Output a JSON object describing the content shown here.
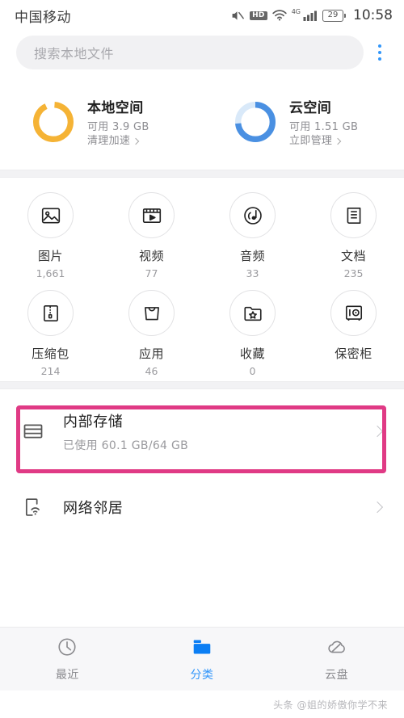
{
  "statusbar": {
    "carrier": "中国移动",
    "hd_label": "HD",
    "network_label": "4G",
    "battery_level": "29",
    "time": "10:58",
    "icons": [
      "mute-icon",
      "hd-icon",
      "wifi-icon",
      "signal-icon",
      "battery-icon"
    ]
  },
  "search": {
    "placeholder": "搜索本地文件",
    "menu_icon": "kebab-menu-icon"
  },
  "storage": {
    "local": {
      "title": "本地空间",
      "available": "可用 3.9 GB",
      "action": "清理加速",
      "ring_color": "#F5B335",
      "ring_track": "#ffffff",
      "ring_percent": 92
    },
    "cloud": {
      "title": "云空间",
      "available": "可用 1.51 GB",
      "action": "立即管理",
      "ring_color": "#4A90E2",
      "ring_track": "#D9E9F9",
      "ring_percent": 74
    }
  },
  "categories": [
    {
      "label": "图片",
      "count": "1,661",
      "icon": "image-icon"
    },
    {
      "label": "视频",
      "count": "77",
      "icon": "video-icon"
    },
    {
      "label": "音频",
      "count": "33",
      "icon": "audio-icon"
    },
    {
      "label": "文档",
      "count": "235",
      "icon": "document-icon"
    },
    {
      "label": "压缩包",
      "count": "214",
      "icon": "archive-icon"
    },
    {
      "label": "应用",
      "count": "46",
      "icon": "apps-icon"
    },
    {
      "label": "收藏",
      "count": "0",
      "icon": "favorite-folder-icon"
    },
    {
      "label": "保密柜",
      "count": "",
      "icon": "safe-box-icon"
    }
  ],
  "rows": {
    "internal": {
      "title": "内部存储",
      "subtitle": "已使用 60.1 GB/64 GB",
      "icon": "internal-storage-icon",
      "highlight_color": "#E03A85"
    },
    "network": {
      "title": "网络邻居",
      "icon": "network-neighbor-icon"
    }
  },
  "tabbar": {
    "accent_color": "#3296FA",
    "items": [
      {
        "label": "最近",
        "icon": "clock-icon",
        "active": false
      },
      {
        "label": "分类",
        "icon": "folder-icon",
        "active": true
      },
      {
        "label": "云盘",
        "icon": "cloud-icon",
        "active": false
      }
    ]
  },
  "watermark": "头条 @姐的娇傲你学不来"
}
